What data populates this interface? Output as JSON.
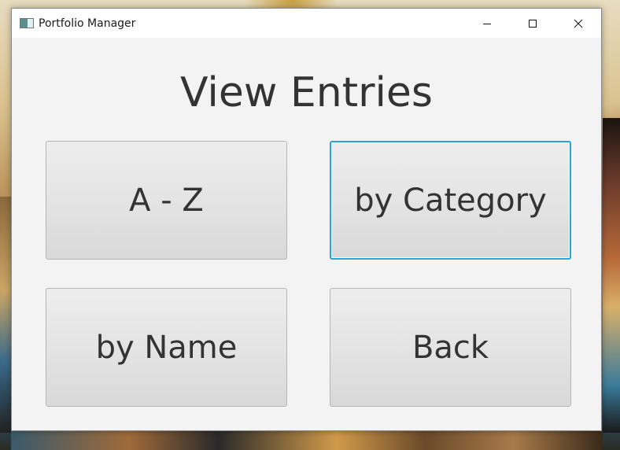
{
  "window": {
    "title": "Portfolio Manager",
    "icon": "app-window-icon",
    "controls": {
      "minimize_icon": "minimize-icon",
      "maximize_icon": "maximize-icon",
      "close_icon": "close-icon"
    }
  },
  "main": {
    "heading": "View Entries",
    "buttons": {
      "az": "A - Z",
      "category": "by Category",
      "name": "by Name",
      "back": "Back"
    },
    "focused_button": "by Category"
  },
  "colors": {
    "focus_ring": "#2aa3dc",
    "window_background": "#f3f3f3",
    "button_text": "#333333"
  }
}
